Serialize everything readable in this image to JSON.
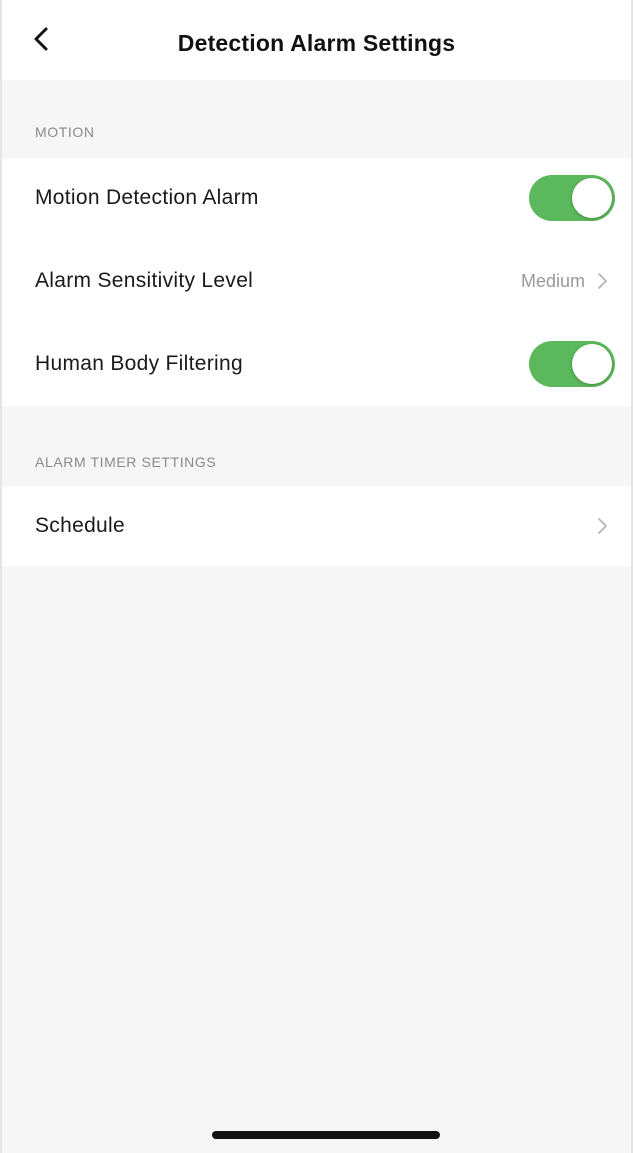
{
  "nav": {
    "title": "Detection Alarm Settings",
    "back_icon": "chevron-left-icon"
  },
  "sections": {
    "motion": {
      "header": "MOTION",
      "rows": {
        "motion_alarm": {
          "label": "Motion Detection Alarm",
          "toggle_on": true
        },
        "sensitivity": {
          "label": "Alarm Sensitivity Level",
          "value": "Medium",
          "icon": "chevron-right-icon"
        },
        "human_filter": {
          "label": "Human Body Filtering",
          "toggle_on": true
        }
      }
    },
    "timer": {
      "header": "ALARM TIMER SETTINGS",
      "rows": {
        "schedule": {
          "label": "Schedule",
          "icon": "chevron-right-icon"
        }
      }
    }
  },
  "colors": {
    "toggle_on": "#5cb85c",
    "background": "#f6f6f6",
    "section_header": "#8a8a8a",
    "secondary_text": "#9a9a9a"
  }
}
